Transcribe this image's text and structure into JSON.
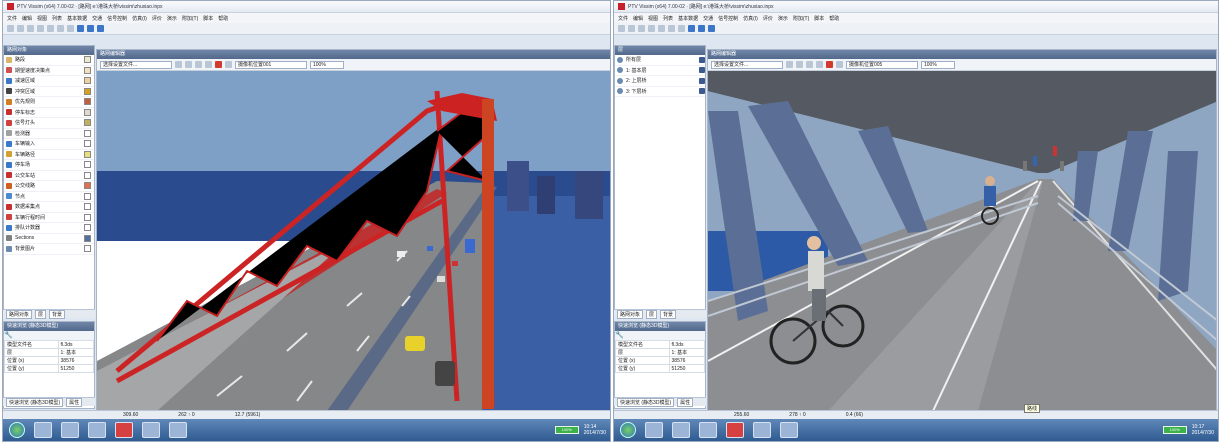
{
  "left_window": {
    "title": "PTV Vissim (x64) 7.00-02 · [路网] e:\\港珠大桥\\vissim\\zhuxiao.inpx",
    "menu": [
      "文件",
      "编辑",
      "视图",
      "列表",
      "基本数据",
      "交通",
      "信号控制",
      "仿真(I)",
      "评价",
      "演示",
      "附加(T)",
      "脚本",
      "帮助"
    ],
    "panel_title": "路网对象",
    "network_objects": [
      {
        "label": "路段",
        "color": "#d9b46b",
        "swatch": "#e9e9d2"
      },
      {
        "label": "期望速度决策点",
        "color": "#d05050",
        "swatch": "#f0e0c0"
      },
      {
        "label": "减速区域",
        "color": "#3a78c8",
        "swatch": "#f0d0a0"
      },
      {
        "label": "冲突区域",
        "color": "#444444",
        "swatch": "#d8a020"
      },
      {
        "label": "优先规则",
        "color": "#d08020",
        "swatch": "#c06040"
      },
      {
        "label": "停车标志",
        "color": "#c83030",
        "swatch": "#e0d8d0"
      },
      {
        "label": "信号灯头",
        "color": "#d04040",
        "swatch": "#c0b060"
      },
      {
        "label": "检测器",
        "color": "#a0a0a0",
        "swatch": "#ffffff"
      },
      {
        "label": "车辆输入",
        "color": "#3a78c8",
        "swatch": "#ffffff"
      },
      {
        "label": "车辆路径",
        "color": "#d0a030",
        "swatch": "#e8e080"
      },
      {
        "label": "停车场",
        "color": "#3a78c8",
        "swatch": "#ffffff"
      },
      {
        "label": "公交车站",
        "color": "#c83030",
        "swatch": "#ffffff"
      },
      {
        "label": "公交线路",
        "color": "#d06020",
        "swatch": "#e07050"
      },
      {
        "label": "节点",
        "color": "#4a8ad0",
        "swatch": "#ffffff"
      },
      {
        "label": "数据采集点",
        "color": "#c83030",
        "swatch": "#ffffff"
      },
      {
        "label": "车辆行程时间",
        "color": "#d04040",
        "swatch": "#ffffff"
      },
      {
        "label": "排队计数器",
        "color": "#3a78c8",
        "swatch": "#ffffff"
      },
      {
        "label": "Sections",
        "color": "#808080",
        "swatch": "#5070a0"
      },
      {
        "label": "背景图片",
        "color": "#6a8ab0",
        "swatch": "#ffffff"
      }
    ],
    "tabs": [
      "路网对象",
      "层",
      "背景"
    ],
    "quick_title": "快速浏览 (静态3D模型)",
    "quick_rows": [
      [
        "模型文件名",
        "fl.3ds"
      ],
      [
        "层",
        "1: 基本"
      ],
      [
        "位置 (x)",
        "38576"
      ],
      [
        "位置 (y)",
        "51250"
      ]
    ],
    "quick_tabs": [
      "快速浏览 (静态3D模型)",
      "属性"
    ],
    "editor_title": "路网编辑器",
    "view_select": "选择设置文件...",
    "camera_select": "摄像机位置001",
    "zoom": "100%",
    "status": [
      "309.60",
      "262 ↑ 0",
      "12.7 (5961)"
    ]
  },
  "right_window": {
    "title": "PTV Vissim (x64) 7.00-02 · [路网] e:\\港珠大桥\\vissim\\zhuxiao.inpx",
    "menu": [
      "文件",
      "编辑",
      "视图",
      "列表",
      "基本数据",
      "交通",
      "信号控制",
      "仿真(I)",
      "评价",
      "演示",
      "附加(T)",
      "脚本",
      "帮助"
    ],
    "panel_title": "层",
    "layers": [
      "所有层",
      "1: 基本层",
      "2: 上层桥",
      "3: 下层桥"
    ],
    "tabs": [
      "路网对象",
      "层",
      "背景"
    ],
    "quick_title": "快速浏览 (静态3D模型)",
    "quick_rows": [
      [
        "模型文件名",
        "fl.3ds"
      ],
      [
        "层",
        "1: 基本"
      ],
      [
        "位置 (x)",
        "38576"
      ],
      [
        "位置 (y)",
        "51250"
      ]
    ],
    "quick_tabs": [
      "快速浏览 (静态3D模型)",
      "属性"
    ],
    "editor_title": "路网编辑器",
    "view_select": "选择设置文件...",
    "camera_select": "摄像机位置005",
    "zoom": "100%",
    "status": [
      "255.60",
      "278 ↑ 0",
      "0.4 (66)"
    ],
    "tooltip": "路线"
  },
  "taskbar": {
    "battery_left": "100%",
    "battery_right": "100%",
    "clock_left": "10:14\n2014/7/30",
    "clock_right": "10:17\n2014/7/30"
  }
}
